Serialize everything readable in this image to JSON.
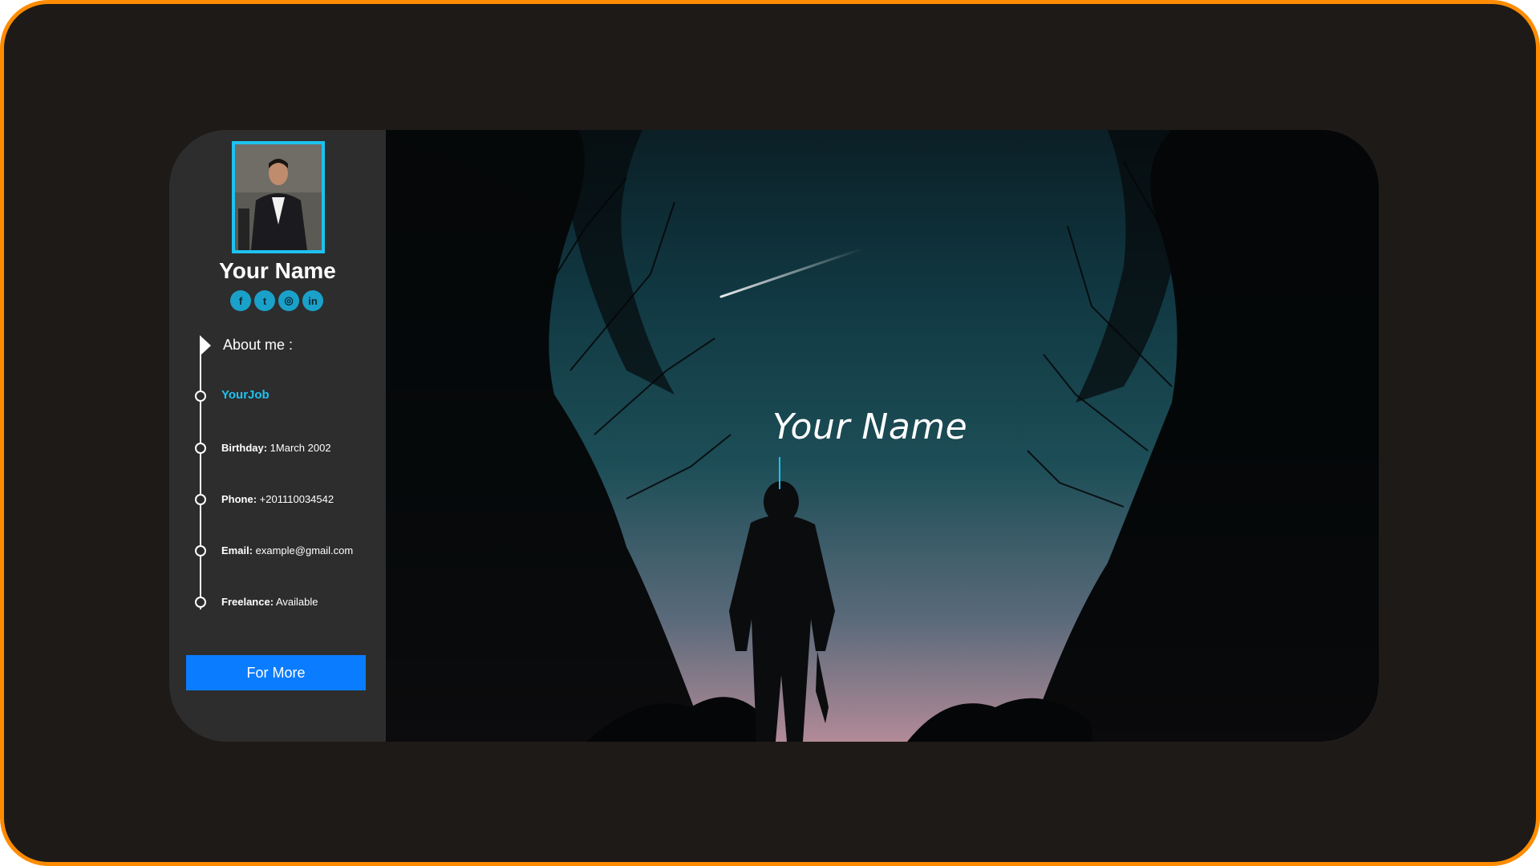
{
  "profile": {
    "name": "Your Name",
    "socials": [
      {
        "icon": "facebook-icon",
        "glyph": "f"
      },
      {
        "icon": "twitter-icon",
        "glyph": "t"
      },
      {
        "icon": "instagram-icon",
        "glyph": "◎"
      },
      {
        "icon": "linkedin-icon",
        "glyph": "in"
      }
    ]
  },
  "about": {
    "heading": "About me :",
    "job": "YourJob",
    "birthday_label": "Birthday:",
    "birthday_value": " 1March 2002",
    "phone_label": "Phone:",
    "phone_value": " +201110034542",
    "email_label": "Email:",
    "email_value": " example@gmail.com",
    "freelance_label": "Freelance:",
    "freelance_value": " Available"
  },
  "actions": {
    "more_label": "For More"
  },
  "hero": {
    "title": "Your Name"
  },
  "colors": {
    "frame_border": "#ff8c00",
    "accent": "#1ec1f0",
    "button": "#0a7cff"
  }
}
